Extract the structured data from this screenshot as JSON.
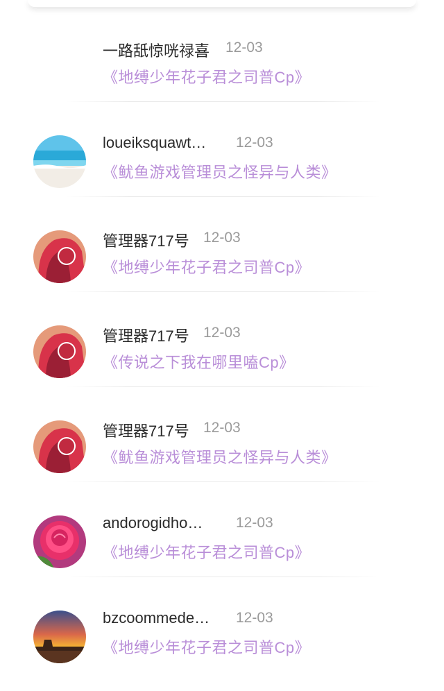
{
  "items": [
    {
      "name": "一路舐惊咣禄喜",
      "date": "12-03",
      "title": "《地缚少年花子君之司普Cp》",
      "avatar": "none"
    },
    {
      "name": "loueiksquawt…",
      "date": "12-03",
      "title": "《鱿鱼游戏管理员之怪异与人类》",
      "avatar": "beach"
    },
    {
      "name": "管理器717号",
      "date": "12-03",
      "title": "《地缚少年花子君之司普Cp》",
      "avatar": "squid-guard"
    },
    {
      "name": "管理器717号",
      "date": "12-03",
      "title": "《传说之下我在哪里嗑Cp》",
      "avatar": "squid-guard"
    },
    {
      "name": "管理器717号",
      "date": "12-03",
      "title": "《鱿鱼游戏管理员之怪异与人类》",
      "avatar": "squid-guard"
    },
    {
      "name": "andorogidho…",
      "date": "12-03",
      "title": "《地缚少年花子君之司普Cp》",
      "avatar": "rose"
    },
    {
      "name": "bzcoommede…",
      "date": "12-03",
      "title": "《地缚少年花子君之司普Cp》",
      "avatar": "sunset"
    }
  ]
}
